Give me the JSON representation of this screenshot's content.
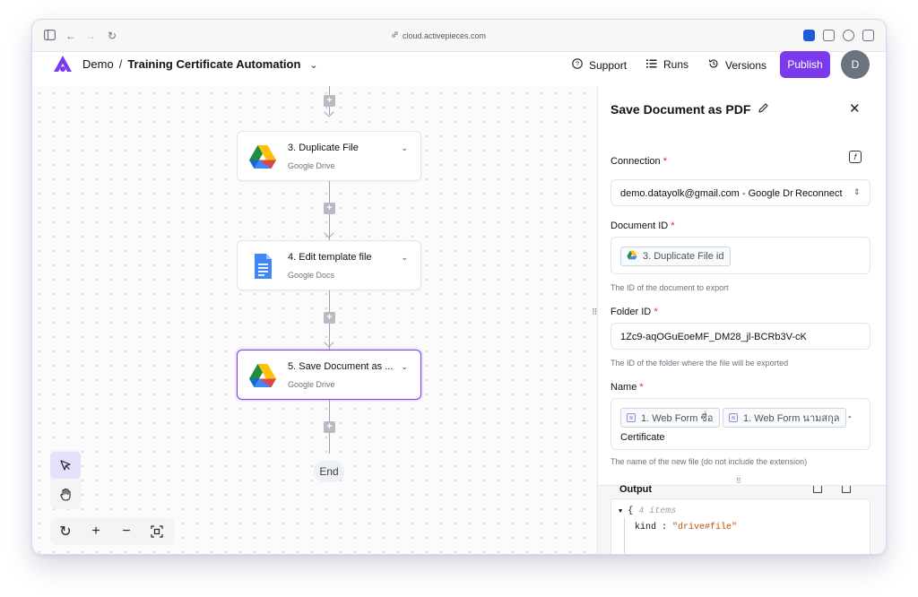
{
  "browser": {
    "url": "cloud.activepieces.com"
  },
  "header": {
    "project": "Demo",
    "separator": "/",
    "flow_name": "Training Certificate Automation",
    "support_label": "Support",
    "runs_label": "Runs",
    "versions_label": "Versions",
    "publish_label": "Publish",
    "avatar_initial": "D",
    "accent_color": "#7c3aed"
  },
  "flow": {
    "steps": [
      {
        "title": "3. Duplicate File",
        "subtitle": "Google Drive",
        "icon": "google-drive-icon"
      },
      {
        "title": "4. Edit template file",
        "subtitle": "Google Docs",
        "icon": "google-docs-icon"
      },
      {
        "title": "5. Save Document as ...",
        "subtitle": "Google Drive",
        "icon": "google-drive-icon"
      }
    ],
    "end_label": "End"
  },
  "panel": {
    "title": "Save Document as PDF",
    "connection_label": "Connection",
    "connection_value": "demo.datayolk@gmail.com - Google Dr",
    "reconnect_label": "Reconnect",
    "document_id_label": "Document ID",
    "document_id_chip": "3. Duplicate File id",
    "document_id_hint": "The ID of the document to export",
    "folder_id_label": "Folder ID",
    "folder_id_value": "1Zc9-aqOGuEoeMF_DM28_jl-BCRb3V-cK",
    "folder_id_hint": "The ID of the folder where the file will be exported",
    "name_label": "Name",
    "name_chip_1": "1. Web Form ชื่อ",
    "name_chip_2": "1. Web Form นามสกุล",
    "name_dash": "-",
    "name_suffix": "Certificate",
    "name_hint": "The name of the new file (do not include the extension)",
    "required_mark": "*",
    "output_title": "Output",
    "output_count": "4 items",
    "output_key": "kind",
    "output_value": "\"drive#file\""
  }
}
